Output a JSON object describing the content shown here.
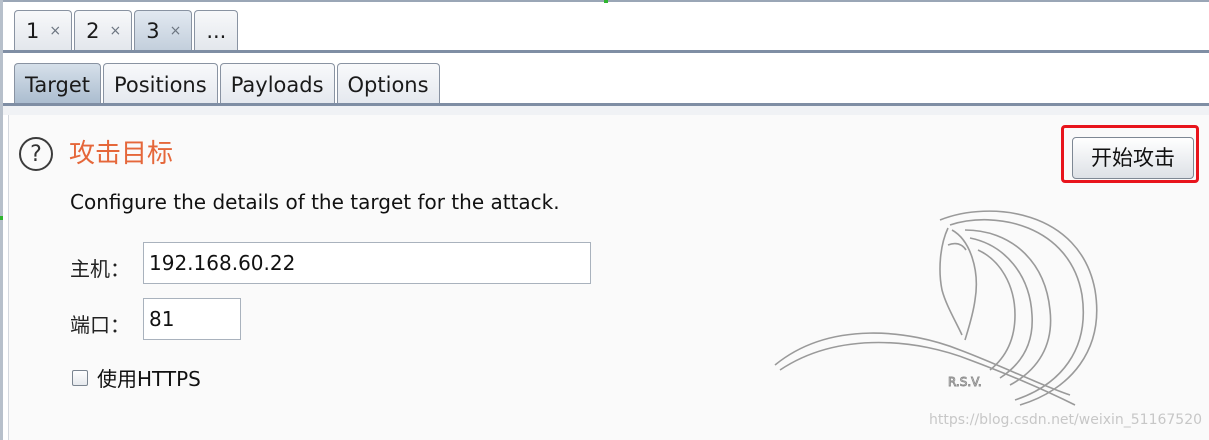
{
  "tabs_top": [
    {
      "label": "1",
      "close": "×"
    },
    {
      "label": "2",
      "close": "×"
    },
    {
      "label": "3",
      "close": "×",
      "active": true
    },
    {
      "label": "..."
    }
  ],
  "tabs_sub": [
    {
      "label": "Target",
      "active": true
    },
    {
      "label": "Positions"
    },
    {
      "label": "Payloads"
    },
    {
      "label": "Options"
    }
  ],
  "section": {
    "help_icon": "?",
    "title": "攻击目标",
    "description": "Configure the details of the target for the attack."
  },
  "form": {
    "host_label": "主机：",
    "host_value": "192.168.60.22",
    "port_label": "端口：",
    "port_value": "81",
    "https_label": "使用HTTPS",
    "https_checked": false
  },
  "start_button": "开始攻击",
  "logo_text": "R.S.V.",
  "watermark": "https://blog.csdn.net/weixin_51167520",
  "colors": {
    "title": "#e5673a",
    "highlight": "#e8141c",
    "tab_active": "#a9bbce"
  }
}
